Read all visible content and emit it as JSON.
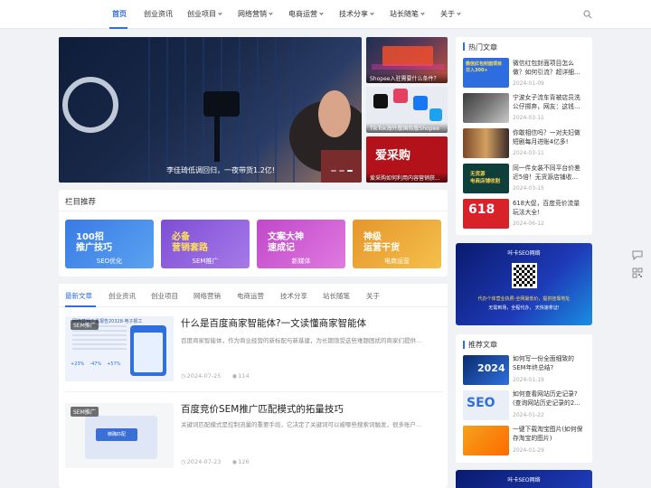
{
  "nav": {
    "items": [
      "首页",
      "创业资讯",
      "创业项目",
      "网络营销",
      "电商运营",
      "技术分享",
      "站长随笔",
      "关于"
    ]
  },
  "slider": {
    "caption": "李佳琦低调回归，一夜带货1.2亿!",
    "side": [
      {
        "caption": "Shopee入驻需要什么条件？"
      },
      {
        "caption": "TikTok海外版国际版Shopee"
      },
      {
        "caption": "爱采购如何利用内容营销获..."
      }
    ],
    "side_logo": "爱采购"
  },
  "column": {
    "title": "栏目推荐",
    "tiles": [
      {
        "big": "100招\n推广技巧",
        "label": "SEO优化",
        "color": "#3b78e0"
      },
      {
        "big": "必备\n营销套路",
        "label": "SEM推广",
        "color": "#8a55d8"
      },
      {
        "big": "文案大神\n速成记",
        "label": "新媒体",
        "color": "#c94fc7"
      },
      {
        "big": "神级\n运营干货",
        "label": "电商运营",
        "color": "#e59a2b"
      }
    ]
  },
  "tabs": [
    "最新文章",
    "创业资讯",
    "创业项目",
    "网络营销",
    "电商运营",
    "技术分享",
    "站长随笔",
    "关于"
  ],
  "articles": [
    {
      "title": "什么是百度商家智能体?一文读懂商家智能体",
      "desc": "百度商家智能体，作为商业经营的新标配与新基建，为长期饱受这些难题困扰的商家们提供...",
      "date": "2024-07-25",
      "views": "114",
      "tag": "SEM推广",
      "thumb_head": "网络营销工具报告20328·电子报工",
      "stats": [
        "+23%",
        "-47%",
        "+57%"
      ]
    },
    {
      "title": "百度竞价SEM推广匹配模式的拓量技巧",
      "desc": "关键词匹配模式是控制流量的重要手段，它决定了关键词可以被哪些搜索词触发，很多账户...",
      "date": "2024-07-23",
      "views": "126",
      "tag": "SEM推广",
      "thumb_box": "精确匹配"
    }
  ],
  "hot": {
    "title": "热门文章",
    "items": [
      {
        "title": "微信红包封面项目怎么做？如何引流？超详细...",
        "date": "2024-01-09",
        "thumb": "微信红包封面项目\n日入300+"
      },
      {
        "title": "宁波女子流车背被店员洗公仔掷弃，网友：这钱...",
        "date": "2024-03-11",
        "thumb": ""
      },
      {
        "title": "你敢相信吗？一对夫妇做短剧每月进账4亿多!",
        "date": "2024-03-11",
        "thumb": ""
      },
      {
        "title": "同一件女装不同平台价差近5倍！无货源店铺收...",
        "date": "2024-03-15",
        "thumb": "无货源\n电商店铺收割"
      },
      {
        "title": "618大促，百度竞价流量玩法大全!",
        "date": "2024-06-12",
        "thumb": "618"
      }
    ]
  },
  "ad": {
    "title": "咔卡SEO网络",
    "line1": "代办个体营业执照-全网最低价，提供挂靠地址",
    "line2": "无需到场，全程代办，  天快速拿证!"
  },
  "recommend": {
    "title": "推荐文章",
    "items": [
      {
        "title": "如何写一份全面细致的SEM年终总结?",
        "date": "2024-01-19",
        "thumb": "2024"
      },
      {
        "title": "如何查看网站历史记录?(查询网站历史记录的2...",
        "date": "2024-01-22",
        "thumb": "SEO"
      },
      {
        "title": "一键下载淘宝图片(如何保存淘宝的图片)",
        "date": "2024-01-29",
        "thumb": ""
      }
    ],
    "ad2": "咔卡SEO网络"
  },
  "colors": {
    "accent": "#2f6fde"
  }
}
